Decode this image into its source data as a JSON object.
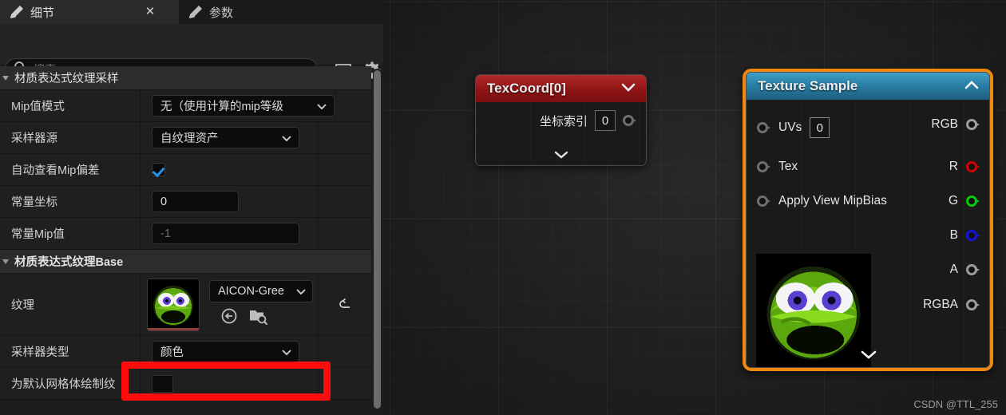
{
  "details_panel": {
    "tabs": [
      {
        "label": "细节",
        "icon": "pencil-icon",
        "active": true,
        "close": "✕"
      },
      {
        "label": "参数",
        "icon": "pencil-icon",
        "active": false
      }
    ],
    "search": {
      "placeholder": "搜索",
      "icon": "search-icon"
    },
    "toolbar": {
      "grid_icon": "table-grid-icon",
      "settings_icon": "gear-icon"
    },
    "categories": [
      {
        "title": "材质表达式纹理采样",
        "rows": [
          {
            "label": "Mip值模式",
            "control": "combo",
            "value": "无（使用计算的mip等级"
          },
          {
            "label": "采样器源",
            "control": "combo",
            "value": "自纹理资产"
          },
          {
            "label": "自动查看Mip偏差",
            "control": "checkbox",
            "value": "checked"
          },
          {
            "label": "常量坐标",
            "control": "number",
            "value": "0"
          },
          {
            "label": "常量Mip值",
            "control": "number-dim",
            "value": "-1"
          }
        ]
      },
      {
        "title": "材质表达式纹理Base",
        "rows": [
          {
            "label": "纹理",
            "control": "asset",
            "value": "AICON-Gree",
            "thumbnail": "green-monster-texture-thumbnail",
            "buttons": [
              "browse-to-asset-icon",
              "find-in-content-browser-icon"
            ],
            "reset": "reset-to-default-icon"
          },
          {
            "label": "采样器类型",
            "control": "combo",
            "value": "颜色",
            "highlighted": true
          },
          {
            "label": "为默认网格体绘制纹",
            "control": "swatch",
            "value": ""
          }
        ]
      }
    ],
    "scrollbar": "vertical-scrollbar"
  },
  "graph": {
    "nodes": [
      {
        "id": "texcoord",
        "title": "TexCoord[0]",
        "collapse_icon": "chevron-down-icon",
        "header_color": "#9e1d1d",
        "param_label": "坐标索引",
        "param_value": "0",
        "output_pin": "uv-output-pin",
        "expand_icon": "chevron-down-icon"
      },
      {
        "id": "texture-sample",
        "title": "Texture Sample",
        "collapse_icon": "chevron-up-icon",
        "header_color": "#2a7fa6",
        "selected_outline": "#f0870e",
        "inputs": [
          {
            "label": "UVs",
            "field": "0"
          },
          {
            "label": "Tex"
          },
          {
            "label": "Apply View MipBias"
          }
        ],
        "outputs": [
          {
            "label": "RGB",
            "color": "#9d9d9d"
          },
          {
            "label": "R",
            "color": "#d40000"
          },
          {
            "label": "G",
            "color": "#08c808"
          },
          {
            "label": "B",
            "color": "#1414e0"
          },
          {
            "label": "A",
            "color": "#9d9d9d"
          },
          {
            "label": "RGBA",
            "color": "#9d9d9d"
          }
        ],
        "preview": "green-monster-texture-preview",
        "expand_icon": "chevron-down-icon"
      }
    ]
  },
  "watermark": "CSDN @TTL_255"
}
